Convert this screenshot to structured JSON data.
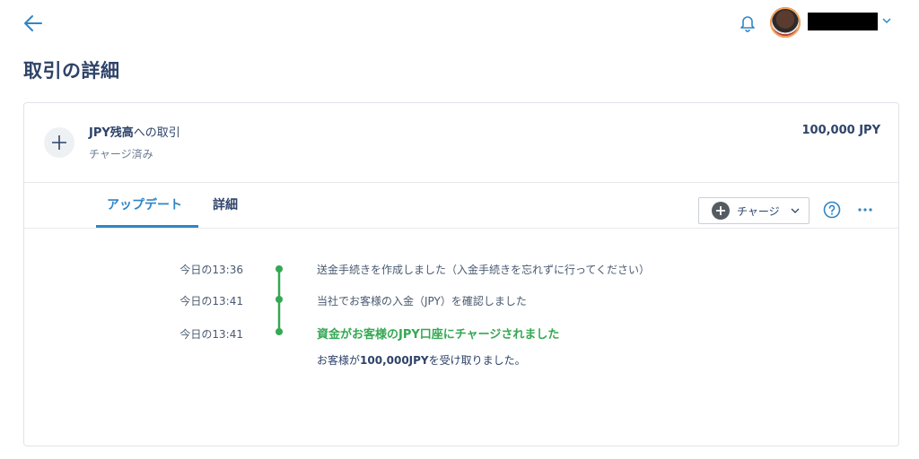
{
  "header": {
    "page_title": "取引の詳細"
  },
  "summary": {
    "title_bold": "JPY残高",
    "title_rest": "への取引",
    "status": "チャージ済み",
    "amount": "100,000 JPY"
  },
  "tabs": [
    {
      "label": "アップデート",
      "active": true
    },
    {
      "label": "詳細",
      "active": false
    }
  ],
  "actions": {
    "charge_label": "チャージ"
  },
  "timeline": [
    {
      "time": "今日の13:36",
      "text": "送金手続きを作成しました（入金手続きを忘れずに行ってください）"
    },
    {
      "time": "今日の13:41",
      "text": "当社でお客様の入金（JPY）を確認しました"
    },
    {
      "time": "今日の13:41",
      "text": "資金がお客様のJPY口座にチャージされました",
      "sub_prefix": "お客様が",
      "sub_amount": "100,000JPY",
      "sub_suffix": "を受け取りました。"
    }
  ],
  "colors": {
    "accent": "#2f86c6",
    "success": "#35a853",
    "text": "#2e4369"
  },
  "icons": [
    "back-arrow-icon",
    "bell-icon",
    "chevron-down-icon",
    "plus-icon",
    "help-icon",
    "more-icon"
  ]
}
